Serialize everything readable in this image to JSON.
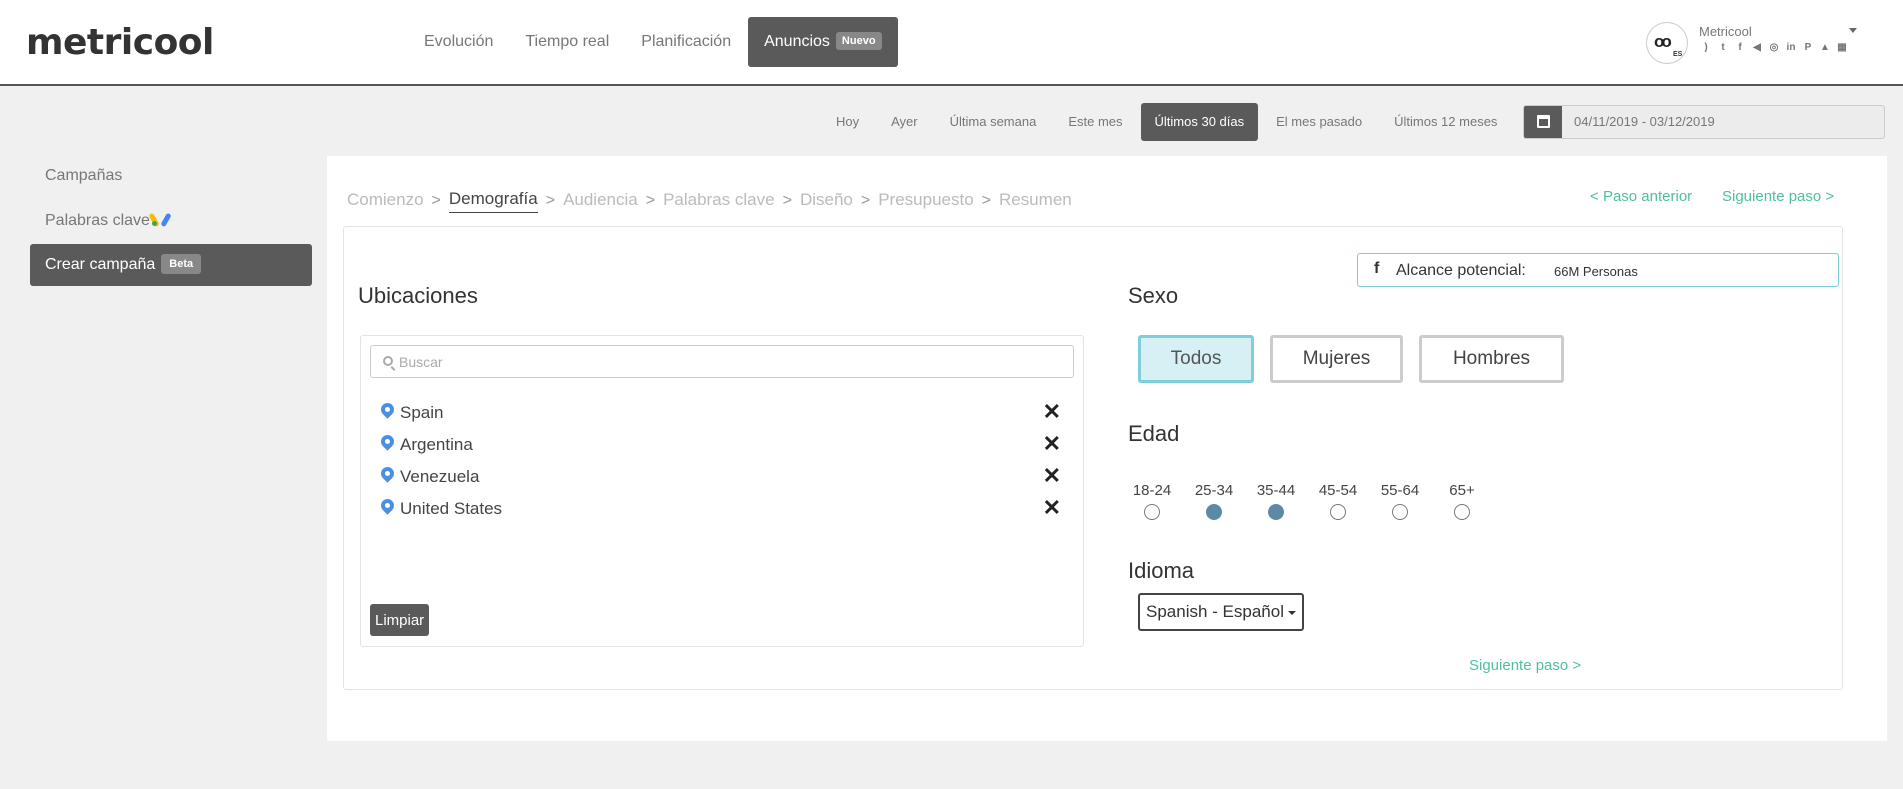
{
  "app": {
    "logo": "metricool"
  },
  "nav": [
    {
      "label": "Evolución"
    },
    {
      "label": "Tiempo real"
    },
    {
      "label": "Planificación"
    },
    {
      "label": "Anuncios",
      "badge": "Nuevo",
      "active": true
    }
  ],
  "account": {
    "name": "Metricool",
    "avatar_text": "oo",
    "avatar_sub": "ES",
    "icons": [
      "rss-icon",
      "twitter-icon",
      "facebook-icon",
      "megaphone-icon",
      "instagram-icon",
      "linkedin-icon",
      "pinterest-icon",
      "google-ads-icon",
      "store-icon"
    ]
  },
  "date_bar": {
    "options": [
      "Hoy",
      "Ayer",
      "Última semana",
      "Este mes",
      "Últimos 30 días",
      "El mes pasado",
      "Últimos 12 meses"
    ],
    "active": "Últimos 30 días",
    "range": "04/11/2019 - 03/12/2019"
  },
  "sidebar": {
    "items": [
      {
        "label": "Campañas"
      },
      {
        "label": "Palabras clave"
      },
      {
        "label": "Crear campaña",
        "badge": "Beta",
        "active": true
      }
    ]
  },
  "breadcrumb": {
    "steps": [
      "Comienzo",
      "Demografía",
      "Audiencia",
      "Palabras clave",
      "Diseño",
      "Presupuesto",
      "Resumen"
    ],
    "active": "Demografía",
    "prev_label": "Paso anterior",
    "next_label": "Siguiente paso",
    "sep": ">",
    "prev_arrow": "<",
    "next_arrow": ">"
  },
  "reach": {
    "label": "Alcance potencial:",
    "value": "66M Personas",
    "fb_glyph": "f"
  },
  "locations": {
    "title": "Ubicaciones",
    "search_placeholder": "Buscar",
    "items": [
      "Spain",
      "Argentina",
      "Venezuela",
      "United States"
    ],
    "remove_glyph": "✕",
    "clear_label": "Limpiar"
  },
  "sex": {
    "title": "Sexo",
    "options": [
      "Todos",
      "Mujeres",
      "Hombres"
    ],
    "selected": "Todos"
  },
  "age": {
    "title": "Edad",
    "ranges": [
      "18-24",
      "25-34",
      "35-44",
      "45-54",
      "55-64",
      "65+"
    ],
    "selected": [
      "25-34",
      "35-44"
    ]
  },
  "language": {
    "title": "Idioma",
    "selected": "Spanish - Español"
  },
  "footer": {
    "next_label": "Siguiente paso"
  },
  "colors": {
    "accent": "#4fbf9f",
    "dark": "#5a5a5a",
    "selected_radio": "#5c8aa6",
    "selected_sex": "#d6f0f3",
    "pin": "#4a90e2"
  }
}
